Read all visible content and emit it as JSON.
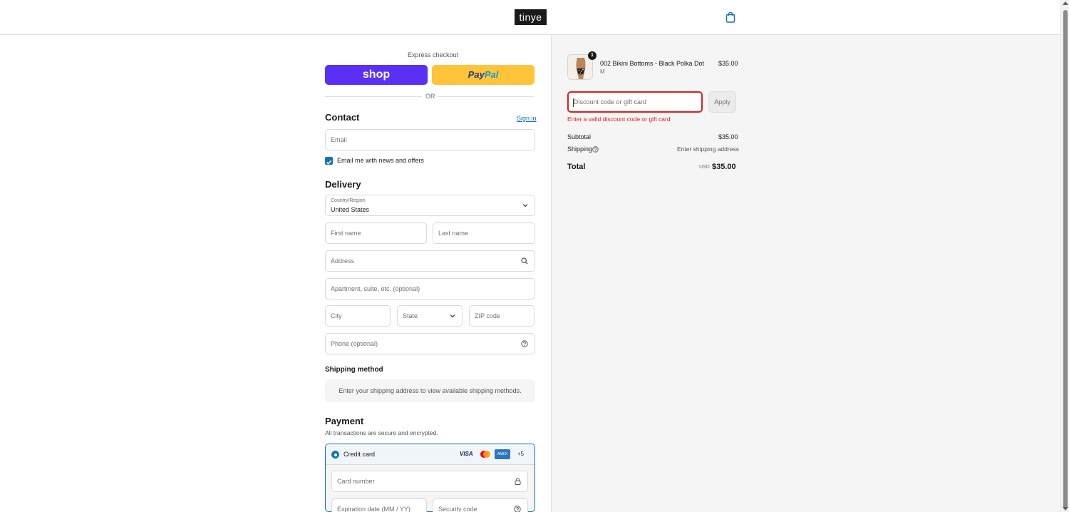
{
  "header": {
    "logo": "tinye",
    "cart_icon": "shopping-bag-icon"
  },
  "express": {
    "label": "Express checkout",
    "shop_label": "shop",
    "paypal_part1": "Pay",
    "paypal_part2": "Pal",
    "or_label": "OR"
  },
  "contact": {
    "title": "Contact",
    "sign_in": "Sign in",
    "email_placeholder": "Email",
    "newsletter_label": "Email me with news and offers",
    "newsletter_checked": true
  },
  "delivery": {
    "title": "Delivery",
    "country_label": "Country/Region",
    "country_value": "United States",
    "first_name": "First name",
    "last_name": "Last name",
    "address": "Address",
    "apartment": "Apartment, suite, etc. (optional)",
    "city": "City",
    "state": "State",
    "zip": "ZIP code",
    "phone": "Phone (optional)"
  },
  "shipping_method": {
    "title": "Shipping method",
    "message": "Enter your shipping address to view available shipping methods."
  },
  "payment": {
    "title": "Payment",
    "subtitle": "All transactions are secure and encrypted.",
    "method": "Credit card",
    "card_visa": "VISA",
    "card_amex": "AMEX",
    "more_cards": "+5",
    "card_number": "Card number",
    "expiration": "Expiration date (MM / YY)",
    "security_code": "Security code"
  },
  "summary": {
    "item": {
      "name": "002 Bikini Bottoms - Black Polka Dot",
      "variant": "M",
      "price": "$35.00",
      "quantity": "1"
    },
    "discount_placeholder": "Discount code or gift card",
    "apply": "Apply",
    "error": "Enter a valid discount code or gift card",
    "subtotal_label": "Subtotal",
    "subtotal_value": "$35.00",
    "shipping_label": "Shipping",
    "shipping_value": "Enter shipping address",
    "total_label": "Total",
    "currency": "USD",
    "total_value": "$35.00"
  },
  "colors": {
    "accent": "#1773b0",
    "shop": "#5a31f4",
    "paypal": "#ffc439",
    "error": "#dd1d1d"
  }
}
